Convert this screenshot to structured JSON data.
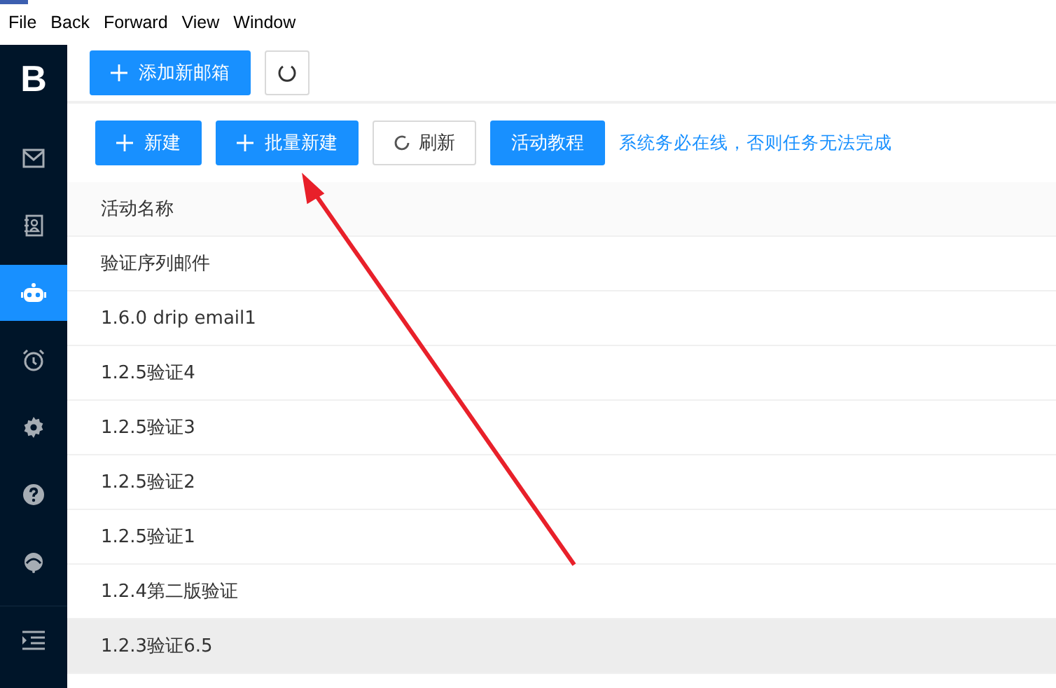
{
  "menu": [
    "File",
    "Back",
    "Forward",
    "View",
    "Window"
  ],
  "sidebar": {
    "logo": "B",
    "items": [
      {
        "selected": false
      },
      {
        "selected": false
      },
      {
        "selected": true
      },
      {
        "selected": false
      },
      {
        "selected": false
      },
      {
        "selected": false
      },
      {
        "selected": false
      }
    ]
  },
  "top": {
    "add_button": "添加新邮箱"
  },
  "toolbar": {
    "buttons": [
      {
        "label": "新建",
        "kind": "plus"
      },
      {
        "label": "批量新建",
        "kind": "plus"
      },
      {
        "label": "刷新",
        "kind": "refresh"
      },
      {
        "label": "活动教程",
        "kind": "plain"
      }
    ],
    "notice": "系统务必在线，否则任务无法完成"
  },
  "table": {
    "columns": [
      "活动名称"
    ],
    "rows": [
      {
        "name": "验证序列邮件",
        "highlighted": false
      },
      {
        "name": "1.6.0 drip email1",
        "highlighted": false
      },
      {
        "name": "1.2.5验证4",
        "highlighted": false
      },
      {
        "name": "1.2.5验证3",
        "highlighted": false
      },
      {
        "name": "1.2.5验证2",
        "highlighted": false
      },
      {
        "name": "1.2.5验证1",
        "highlighted": false
      },
      {
        "name": "1.2.4第二版验证",
        "highlighted": false
      },
      {
        "name": "1.2.3验证6.5",
        "highlighted": true
      }
    ]
  }
}
